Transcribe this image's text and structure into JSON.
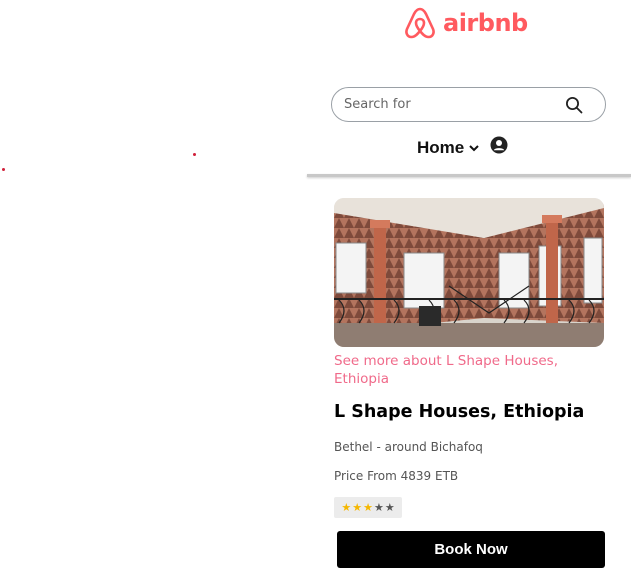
{
  "brand": {
    "name": "airbnb",
    "color": "#ff5a5f"
  },
  "search": {
    "placeholder": "Search for",
    "icon": "search-icon"
  },
  "nav": {
    "home_label": "Home",
    "dropdown_icon": "chevron-down-icon",
    "user_icon": "user-circle-icon"
  },
  "listing": {
    "image_alt": "L Shape Houses courtyard",
    "see_more_link": "See more about L Shape Houses, Ethiopia",
    "title": "L Shape Houses, Ethiopia",
    "location": "Bethel - around Bichafoq",
    "price": "Price From 4839 ETB",
    "rating": {
      "filled": 3,
      "total": 5
    },
    "link_color": "#f06a8a"
  },
  "actions": {
    "book_label": "Book Now"
  }
}
